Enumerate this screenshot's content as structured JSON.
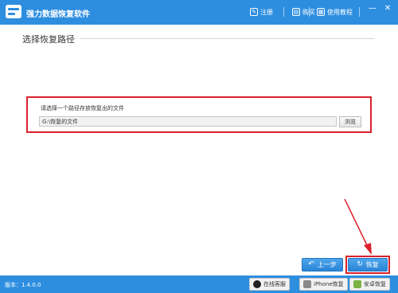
{
  "app": {
    "title": "强力数据恢复软件",
    "version": "版本：1.4.0.0"
  },
  "menu": [
    {
      "label": "注册",
      "icon": "register-icon",
      "glyph": "✎"
    },
    {
      "label": "购买",
      "icon": "cart-icon",
      "glyph": "▤"
    },
    {
      "label": "使用教程",
      "icon": "tutorial-icon",
      "glyph": "▦"
    }
  ],
  "window_controls": {
    "minimize": "—",
    "close": "✕"
  },
  "section": {
    "title": "选择恢复路径"
  },
  "path": {
    "label": "请选择一个路径存放恢复出的文件",
    "value": "G:\\恢复的文件",
    "browse_label": "浏览"
  },
  "nav": {
    "prev_label": "上一步",
    "prev_glyph": "↶",
    "recover_label": "恢复",
    "recover_glyph": "↻"
  },
  "status": {
    "qq_label": "在线客服",
    "iphone_label": "iPhone恢复",
    "android_label": "安卓恢复"
  },
  "colors": {
    "accent": "#2d8ee0",
    "highlight": "#d9212b"
  }
}
